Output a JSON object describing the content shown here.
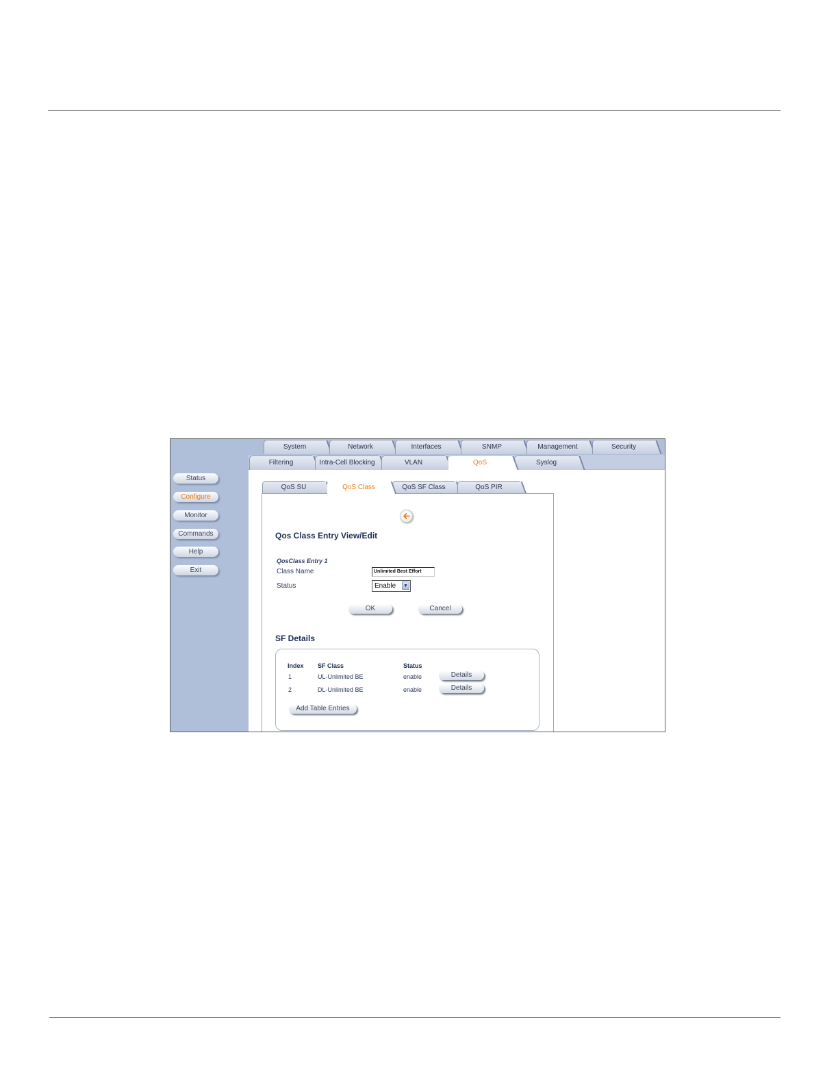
{
  "sidebar": {
    "items": [
      {
        "label": "Status",
        "active": false
      },
      {
        "label": "Configure",
        "active": true
      },
      {
        "label": "Monitor",
        "active": false
      },
      {
        "label": "Commands",
        "active": false
      },
      {
        "label": "Help",
        "active": false
      },
      {
        "label": "Exit",
        "active": false
      }
    ]
  },
  "tabs_row1": [
    "System",
    "Network",
    "Interfaces",
    "SNMP",
    "Management",
    "Security"
  ],
  "tabs_row2": [
    "Filtering",
    "Intra-Cell Blocking",
    "VLAN",
    "QoS",
    "Syslog"
  ],
  "tabs_row2_active": "QoS",
  "subtabs": [
    "QoS SU",
    "QoS Class",
    "QoS SF Class",
    "QoS PIR"
  ],
  "subtabs_active": "QoS Class",
  "icons": {
    "back": "back-arrow-icon",
    "select_arrow": "chevron-down-icon"
  },
  "colors": {
    "accent": "#e87a1a",
    "sidebar": "#b0bfd9",
    "heading": "#1c2d55"
  },
  "form": {
    "title": "Qos Class Entry View/Edit",
    "entry_label": "QosClass Entry 1",
    "class_name_label": "Class Name",
    "class_name_value": "Unlimited Best Effort",
    "status_label": "Status",
    "status_value": "Enable",
    "ok_label": "OK",
    "cancel_label": "Cancel"
  },
  "sf_details": {
    "title": "SF Details",
    "headers": {
      "index": "Index",
      "sf_class": "SF Class",
      "status": "Status"
    },
    "rows": [
      {
        "index": "1",
        "sf_class": "UL-Unlimited BE",
        "status": "enable",
        "action": "Details"
      },
      {
        "index": "2",
        "sf_class": "DL-Unlimited BE",
        "status": "enable",
        "action": "Details"
      }
    ],
    "add_label": "Add Table Entries"
  }
}
